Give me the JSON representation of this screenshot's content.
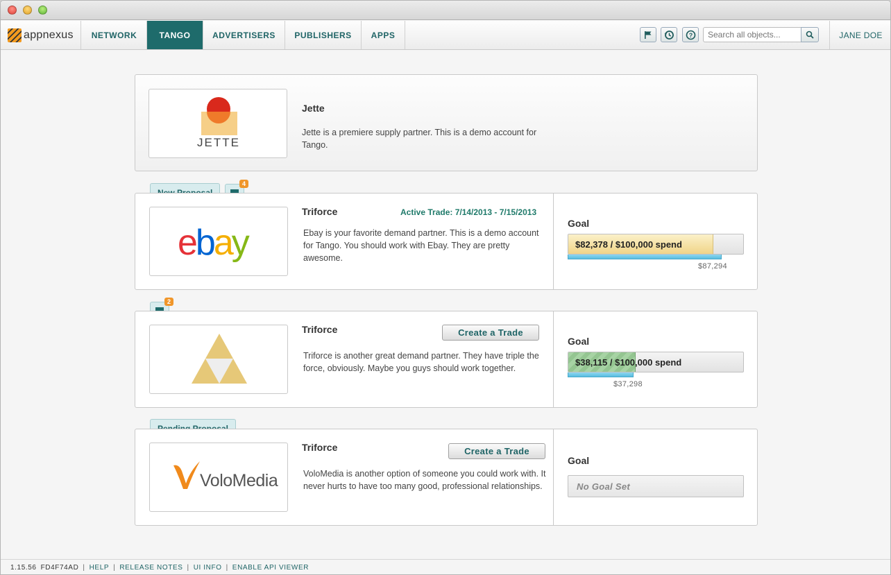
{
  "nav": {
    "logo_text": "appnexus",
    "items": [
      "NETWORK",
      "TANGO",
      "ADVERTISERS",
      "PUBLISHERS",
      "APPS"
    ],
    "active": "TANGO",
    "search_placeholder": "Search all objects...",
    "user": "JANE DOE",
    "icons": [
      "flag-icon",
      "history-icon",
      "help-icon",
      "search-icon"
    ]
  },
  "header_card": {
    "logo_text": "JETTE",
    "name": "Jette",
    "description": "Jette is a premiere supply partner. This is a demo account for Tango."
  },
  "partners": [
    {
      "tag": "New Proposal",
      "comment_count": "4",
      "logo": "ebay",
      "name": "Triforce",
      "active_trade": "Active Trade: 7/14/2013 - 7/15/2013",
      "description": "Ebay is your favorite demand partner. This is a demo account for Tango. You should work with Ebay. They are pretty awesome.",
      "goal_label": "Goal",
      "goal_text": "$82,378 / $100,000 spend",
      "goal_progress": 0.82378,
      "pace_value": "$87,294",
      "pace_progress": 0.87294,
      "bar_color": "#f0d488"
    },
    {
      "tag": "",
      "comment_count": "2",
      "logo": "triforce",
      "name": "Triforce",
      "button": "Create a Trade",
      "description": "Triforce is another great demand partner. They have triple the force, obviously. Maybe you guys should work together.",
      "goal_label": "Goal",
      "goal_text": "$38,115 / $100,000 spend",
      "goal_progress": 0.38115,
      "pace_value": "$37,298",
      "pace_progress": 0.37298,
      "bar_color": "#94c591"
    },
    {
      "tag": "Pending Proposal",
      "logo": "VoloMedia",
      "name": "Triforce",
      "button": "Create a Trade",
      "description": "VoloMedia is another option of someone you could work with. It never hurts to have too many good, professional relationships.",
      "goal_label": "Goal",
      "no_goal": "No Goal Set"
    }
  ],
  "footer": {
    "version": "1.15.56",
    "build": "FD4F74AD",
    "links": [
      "HELP",
      "RELEASE NOTES",
      "UI INFO",
      "ENABLE API VIEWER"
    ]
  },
  "colors": {
    "brand_teal": "#1e6b6b",
    "accent_orange": "#f0962a",
    "pace_blue": "#59bde0"
  }
}
